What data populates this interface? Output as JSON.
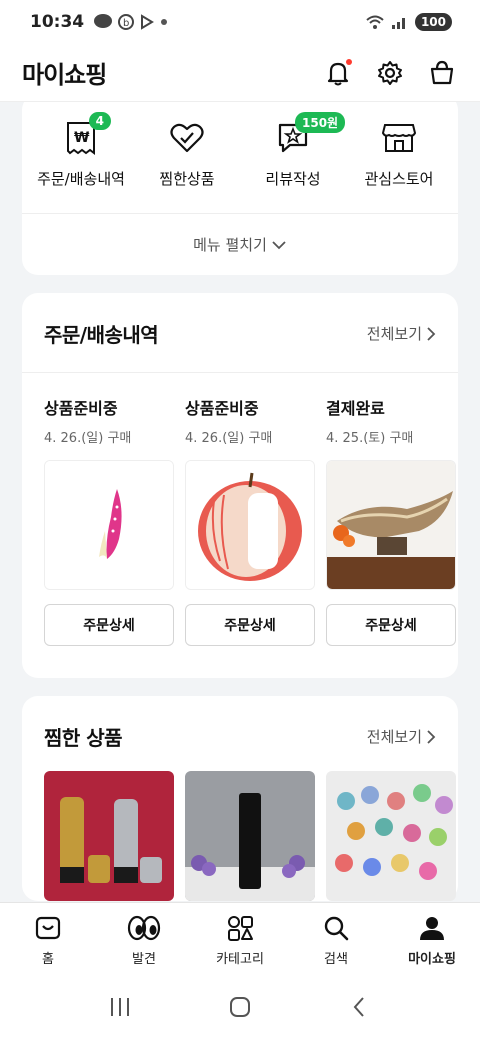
{
  "status": {
    "time": "10:34",
    "battery": "100"
  },
  "header": {
    "title": "마이쇼핑"
  },
  "quick_menu": {
    "items": [
      {
        "label": "주문/배송내역",
        "badge": "4"
      },
      {
        "label": "찜한상품"
      },
      {
        "label": "리뷰작성",
        "badge": "150원"
      },
      {
        "label": "관심스토어"
      }
    ],
    "expand_label": "메뉴 펼치기"
  },
  "orders_section": {
    "title": "주문/배송내역",
    "see_all": "전체보기",
    "orders": [
      {
        "status": "상품준비중",
        "date": "4. 26.(일) 구매",
        "button": "주문상세"
      },
      {
        "status": "상품준비중",
        "date": "4. 26.(일) 구매",
        "button": "주문상세"
      },
      {
        "status": "결제완료",
        "date": "4. 25.(토) 구매",
        "button": "주문상세"
      }
    ]
  },
  "wish_section": {
    "title": "찜한 상품",
    "see_all": "전체보기"
  },
  "bottom_nav": {
    "items": [
      {
        "label": "홈"
      },
      {
        "label": "발견"
      },
      {
        "label": "카테고리"
      },
      {
        "label": "검색"
      },
      {
        "label": "마이쇼핑",
        "active": true
      }
    ]
  },
  "colors": {
    "badge_green": "#1db954",
    "notif_red": "#ff3b2f",
    "background": "#f2f4f6"
  }
}
